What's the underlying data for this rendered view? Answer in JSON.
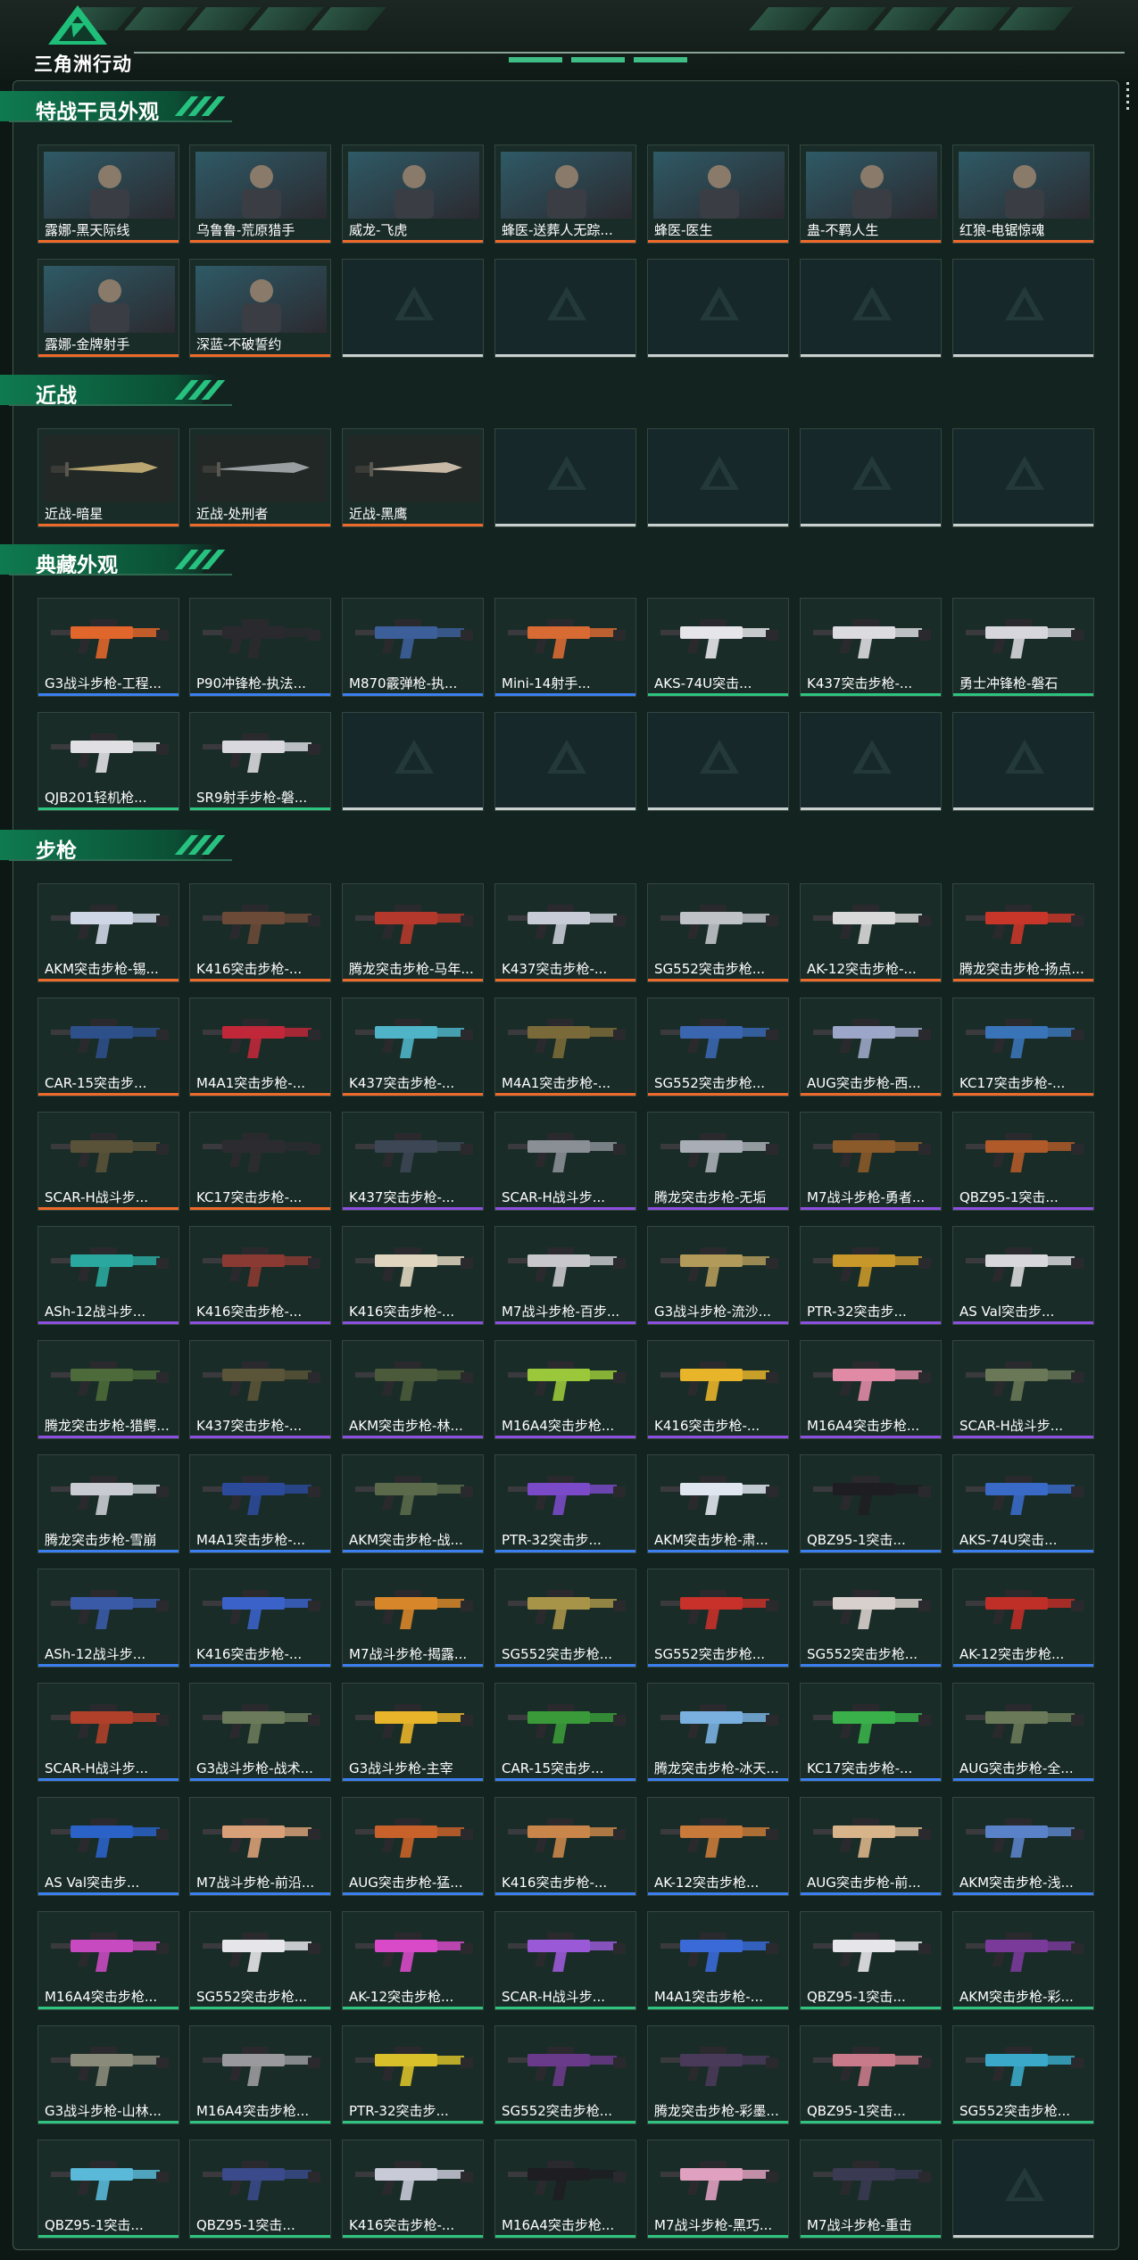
{
  "app_title": "三角洲行动",
  "rarity_colors": {
    "orange": "#ee6a2a",
    "gold": "#e7a43a",
    "purple": "#8c4fe0",
    "blue": "#3b7ff0",
    "green": "#2fc380",
    "gray": "#c9d1cf"
  },
  "sections": [
    {
      "title": "特战干员外观",
      "items": [
        {
          "name": "露娜-黑天际线",
          "rarity": "orange",
          "kind": "photo"
        },
        {
          "name": "乌鲁鲁-荒原猎手",
          "rarity": "orange",
          "kind": "photo"
        },
        {
          "name": "威龙-飞虎",
          "rarity": "orange",
          "kind": "photo"
        },
        {
          "name": "蜂医-送葬人无踪...",
          "rarity": "orange",
          "kind": "photo"
        },
        {
          "name": "蜂医-医生",
          "rarity": "orange",
          "kind": "photo"
        },
        {
          "name": "蛊-不羁人生",
          "rarity": "orange",
          "kind": "photo"
        },
        {
          "name": "红狼-电锯惊魂",
          "rarity": "orange",
          "kind": "photo"
        },
        {
          "name": "露娜-金牌射手",
          "rarity": "orange",
          "kind": "photo"
        },
        {
          "name": "深蓝-不破誓约",
          "rarity": "orange",
          "kind": "photo"
        },
        {
          "empty": true
        },
        {
          "empty": true
        },
        {
          "empty": true
        },
        {
          "empty": true
        },
        {
          "empty": true
        }
      ]
    },
    {
      "title": "近战",
      "items": [
        {
          "name": "近战-暗星",
          "rarity": "orange",
          "kind": "knife",
          "color": "#b9a670"
        },
        {
          "name": "近战-处刑者",
          "rarity": "orange",
          "kind": "knife",
          "color": "#9aa0a2"
        },
        {
          "name": "近战-黑鹰",
          "rarity": "orange",
          "kind": "knife",
          "color": "#c7b9a6"
        },
        {
          "empty": true
        },
        {
          "empty": true
        },
        {
          "empty": true
        },
        {
          "empty": true
        }
      ]
    },
    {
      "title": "典藏外观",
      "items": [
        {
          "name": "G3战斗步枪-工程...",
          "rarity": "blue",
          "kind": "gun",
          "color": "#e0662c"
        },
        {
          "name": "P90冲锋枪-执法...",
          "rarity": "blue",
          "kind": "gun",
          "color": "#2a2a2e"
        },
        {
          "name": "M870霰弹枪-执...",
          "rarity": "blue",
          "kind": "gun",
          "color": "#3c5f9a"
        },
        {
          "name": "Mini-14射手...",
          "rarity": "blue",
          "kind": "gun",
          "color": "#d86a34"
        },
        {
          "name": "AKS-74U突击...",
          "rarity": "green",
          "kind": "gun",
          "color": "#e6e6ea"
        },
        {
          "name": "K437突击步枪-...",
          "rarity": "green",
          "kind": "gun",
          "color": "#dcdce0"
        },
        {
          "name": "勇士冲锋枪-磐石",
          "rarity": "green",
          "kind": "gun",
          "color": "#d6d6dc"
        },
        {
          "name": "QJB201轻机枪...",
          "rarity": "green",
          "kind": "gun",
          "color": "#e0e0e4"
        },
        {
          "name": "SR9射手步枪-磐...",
          "rarity": "green",
          "kind": "gun",
          "color": "#d8d8de"
        },
        {
          "empty": true
        },
        {
          "empty": true
        },
        {
          "empty": true
        },
        {
          "empty": true
        },
        {
          "empty": true
        }
      ]
    },
    {
      "title": "步枪",
      "items": [
        {
          "name": "AKM突击步枪-锡...",
          "rarity": "orange",
          "kind": "gun",
          "color": "#cfd6e6"
        },
        {
          "name": "K416突击步枪-...",
          "rarity": "orange",
          "kind": "gun",
          "color": "#6b4a38"
        },
        {
          "name": "腾龙突击步枪-马年...",
          "rarity": "orange",
          "kind": "gun",
          "color": "#b5382c"
        },
        {
          "name": "K437突击步枪-...",
          "rarity": "orange",
          "kind": "gun",
          "color": "#c8ccd6"
        },
        {
          "name": "SG552突击步枪...",
          "rarity": "orange",
          "kind": "gun",
          "color": "#bfc3c8"
        },
        {
          "name": "AK-12突击步枪-...",
          "rarity": "orange",
          "kind": "gun",
          "color": "#d9d9d9"
        },
        {
          "name": "腾龙突击步枪-扬点...",
          "rarity": "orange",
          "kind": "gun",
          "color": "#c8362a"
        },
        {
          "name": "CAR-15突击步...",
          "rarity": "orange",
          "kind": "gun",
          "color": "#2d4f8a"
        },
        {
          "name": "M4A1突击步枪-...",
          "rarity": "orange",
          "kind": "gun",
          "color": "#c0283a"
        },
        {
          "name": "K437突击步枪-...",
          "rarity": "orange",
          "kind": "gun",
          "color": "#4fb4c8"
        },
        {
          "name": "M4A1突击步枪-...",
          "rarity": "orange",
          "kind": "gun",
          "color": "#7a6a3a"
        },
        {
          "name": "SG552突击步枪...",
          "rarity": "orange",
          "kind": "gun",
          "color": "#3a66b0"
        },
        {
          "name": "AUG突击步枪-西...",
          "rarity": "orange",
          "kind": "gun",
          "color": "#9ca6c8"
        },
        {
          "name": "KC17突击步枪-...",
          "rarity": "orange",
          "kind": "gun",
          "color": "#3a74b8"
        },
        {
          "name": "SCAR-H战斗步...",
          "rarity": "orange",
          "kind": "gun",
          "color": "#5a5238"
        },
        {
          "name": "KC17突击步枪-...",
          "rarity": "orange",
          "kind": "gun",
          "color": "#2c2c30"
        },
        {
          "name": "K437突击步枪-...",
          "rarity": "purple",
          "kind": "gun",
          "color": "#3c4654"
        },
        {
          "name": "SCAR-H战斗步...",
          "rarity": "purple",
          "kind": "gun",
          "color": "#8a8f96"
        },
        {
          "name": "腾龙突击步枪-无垢",
          "rarity": "purple",
          "kind": "gun",
          "color": "#a9aeb6"
        },
        {
          "name": "M7战斗步枪-勇者...",
          "rarity": "purple",
          "kind": "gun",
          "color": "#8a5a2a"
        },
        {
          "name": "QBZ95-1突击...",
          "rarity": "purple",
          "kind": "gun",
          "color": "#b05a2a"
        },
        {
          "name": "ASh-12战斗步...",
          "rarity": "purple",
          "kind": "gun",
          "color": "#2aa8a0"
        },
        {
          "name": "K416突击步枪-...",
          "rarity": "purple",
          "kind": "gun",
          "color": "#8a3a32"
        },
        {
          "name": "K416突击步枪-...",
          "rarity": "purple",
          "kind": "gun",
          "color": "#e0d6c0"
        },
        {
          "name": "M7战斗步枪-百步...",
          "rarity": "purple",
          "kind": "gun",
          "color": "#c8c8cc"
        },
        {
          "name": "G3战斗步枪-流沙...",
          "rarity": "purple",
          "kind": "gun",
          "color": "#b29a5a"
        },
        {
          "name": "PTR-32突击步...",
          "rarity": "purple",
          "kind": "gun",
          "color": "#c8982a"
        },
        {
          "name": "AS Val突击步...",
          "rarity": "purple",
          "kind": "gun",
          "color": "#d8d8dc"
        },
        {
          "name": "腾龙突击步枪-猎鳄...",
          "rarity": "purple",
          "kind": "gun",
          "color": "#4c6a3a"
        },
        {
          "name": "K437突击步枪-...",
          "rarity": "purple",
          "kind": "gun",
          "color": "#5a5438"
        },
        {
          "name": "AKM突击步枪-林...",
          "rarity": "purple",
          "kind": "gun",
          "color": "#4a5a3a"
        },
        {
          "name": "M16A4突击步枪...",
          "rarity": "purple",
          "kind": "gun",
          "color": "#9ac83a"
        },
        {
          "name": "K416突击步枪-...",
          "rarity": "purple",
          "kind": "gun",
          "color": "#e8b42a"
        },
        {
          "name": "M16A4突击步枪...",
          "rarity": "purple",
          "kind": "gun",
          "color": "#e08aa6"
        },
        {
          "name": "SCAR-H战斗步...",
          "rarity": "purple",
          "kind": "gun",
          "color": "#6a7858"
        },
        {
          "name": "腾龙突击步枪-雪崩",
          "rarity": "blue",
          "kind": "gun",
          "color": "#c8ccd2"
        },
        {
          "name": "M4A1突击步枪-...",
          "rarity": "blue",
          "kind": "gun",
          "color": "#2c4a9a"
        },
        {
          "name": "AKM突击步枪-战...",
          "rarity": "blue",
          "kind": "gun",
          "color": "#5a6a4a"
        },
        {
          "name": "PTR-32突击步...",
          "rarity": "blue",
          "kind": "gun",
          "color": "#7a4ac8"
        },
        {
          "name": "AKM突击步枪-肃...",
          "rarity": "blue",
          "kind": "gun",
          "color": "#e0e6f0"
        },
        {
          "name": "QBZ95-1突击...",
          "rarity": "blue",
          "kind": "gun",
          "color": "#1e1e22"
        },
        {
          "name": "AKS-74U突击...",
          "rarity": "blue",
          "kind": "gun",
          "color": "#3a6ac8"
        },
        {
          "name": "ASh-12战斗步...",
          "rarity": "blue",
          "kind": "gun",
          "color": "#3a5aa8"
        },
        {
          "name": "K416突击步枪-...",
          "rarity": "blue",
          "kind": "gun",
          "color": "#3a62c8"
        },
        {
          "name": "M7战斗步枪-揭露...",
          "rarity": "blue",
          "kind": "gun",
          "color": "#d8862a"
        },
        {
          "name": "SG552突击步枪...",
          "rarity": "blue",
          "kind": "gun",
          "color": "#a89448"
        },
        {
          "name": "SG552突击步枪...",
          "rarity": "blue",
          "kind": "gun",
          "color": "#c8302a"
        },
        {
          "name": "SG552突击步枪...",
          "rarity": "blue",
          "kind": "gun",
          "color": "#d8d0cc"
        },
        {
          "name": "AK-12突击步枪...",
          "rarity": "blue",
          "kind": "gun",
          "color": "#c02e28"
        },
        {
          "name": "SCAR-H战斗步...",
          "rarity": "blue",
          "kind": "gun",
          "color": "#b0402a"
        },
        {
          "name": "G3战斗步枪-战术...",
          "rarity": "blue",
          "kind": "gun",
          "color": "#6a7a5a"
        },
        {
          "name": "G3战斗步枪-主宰",
          "rarity": "blue",
          "kind": "gun",
          "color": "#e8b42a"
        },
        {
          "name": "CAR-15突击步...",
          "rarity": "blue",
          "kind": "gun",
          "color": "#3a9a3a"
        },
        {
          "name": "腾龙突击步枪-冰天...",
          "rarity": "blue",
          "kind": "gun",
          "color": "#7ab0e0"
        },
        {
          "name": "KC17突击步枪-...",
          "rarity": "blue",
          "kind": "gun",
          "color": "#3ab04a"
        },
        {
          "name": "AUG突击步枪-全...",
          "rarity": "blue",
          "kind": "gun",
          "color": "#6a7a58"
        },
        {
          "name": "AS Val突击步...",
          "rarity": "blue",
          "kind": "gun",
          "color": "#2a62c8"
        },
        {
          "name": "M7战斗步枪-前沿...",
          "rarity": "blue",
          "kind": "gun",
          "color": "#d8a078"
        },
        {
          "name": "AUG突击步枪-猛...",
          "rarity": "blue",
          "kind": "gun",
          "color": "#c8622a"
        },
        {
          "name": "K416突击步枪-...",
          "rarity": "blue",
          "kind": "gun",
          "color": "#c8864a"
        },
        {
          "name": "AK-12突击步枪...",
          "rarity": "blue",
          "kind": "gun",
          "color": "#c87a3a"
        },
        {
          "name": "AUG突击步枪-前...",
          "rarity": "blue",
          "kind": "gun",
          "color": "#d8b48a"
        },
        {
          "name": "AKM突击步枪-浅...",
          "rarity": "blue",
          "kind": "gun",
          "color": "#5a82c8"
        },
        {
          "name": "M16A4突击步枪...",
          "rarity": "green",
          "kind": "gun",
          "color": "#c84ac0"
        },
        {
          "name": "SG552突击步枪...",
          "rarity": "green",
          "kind": "gun",
          "color": "#e6e6ea"
        },
        {
          "name": "AK-12突击步枪...",
          "rarity": "green",
          "kind": "gun",
          "color": "#d84ac8"
        },
        {
          "name": "SCAR-H战斗步...",
          "rarity": "green",
          "kind": "gun",
          "color": "#9a5ad8"
        },
        {
          "name": "M4A1突击步枪-...",
          "rarity": "green",
          "kind": "gun",
          "color": "#3a6ad8"
        },
        {
          "name": "QBZ95-1突击...",
          "rarity": "green",
          "kind": "gun",
          "color": "#e6e6ea"
        },
        {
          "name": "AKM突击步枪-彩...",
          "rarity": "green",
          "kind": "gun",
          "color": "#7a3a9a"
        },
        {
          "name": "G3战斗步枪-山林...",
          "rarity": "green",
          "kind": "gun",
          "color": "#8a8a7a"
        },
        {
          "name": "M16A4突击步枪...",
          "rarity": "green",
          "kind": "gun",
          "color": "#9a9a9e"
        },
        {
          "name": "PTR-32突击步...",
          "rarity": "green",
          "kind": "gun",
          "color": "#d8c02a"
        },
        {
          "name": "SG552突击步枪...",
          "rarity": "green",
          "kind": "gun",
          "color": "#6a3a8a"
        },
        {
          "name": "腾龙突击步枪-彩墨...",
          "rarity": "green",
          "kind": "gun",
          "color": "#4a3a5a"
        },
        {
          "name": "QBZ95-1突击...",
          "rarity": "green",
          "kind": "gun",
          "color": "#c87a8a"
        },
        {
          "name": "SG552突击步枪...",
          "rarity": "green",
          "kind": "gun",
          "color": "#3aa8c8"
        },
        {
          "name": "QBZ95-1突击...",
          "rarity": "green",
          "kind": "gun",
          "color": "#5ab8d8"
        },
        {
          "name": "QBZ95-1突击...",
          "rarity": "green",
          "kind": "gun",
          "color": "#3a4a8a"
        },
        {
          "name": "K416突击步枪-...",
          "rarity": "green",
          "kind": "gun",
          "color": "#c8cad8"
        },
        {
          "name": "M16A4突击步枪...",
          "rarity": "green",
          "kind": "gun",
          "color": "#1e1e22"
        },
        {
          "name": "M7战斗步枪-黑巧...",
          "rarity": "green",
          "kind": "gun",
          "color": "#e0a0c0"
        },
        {
          "name": "M7战斗步枪-重击",
          "rarity": "green",
          "kind": "gun",
          "color": "#3a3a52"
        },
        {
          "empty": true
        }
      ]
    }
  ]
}
